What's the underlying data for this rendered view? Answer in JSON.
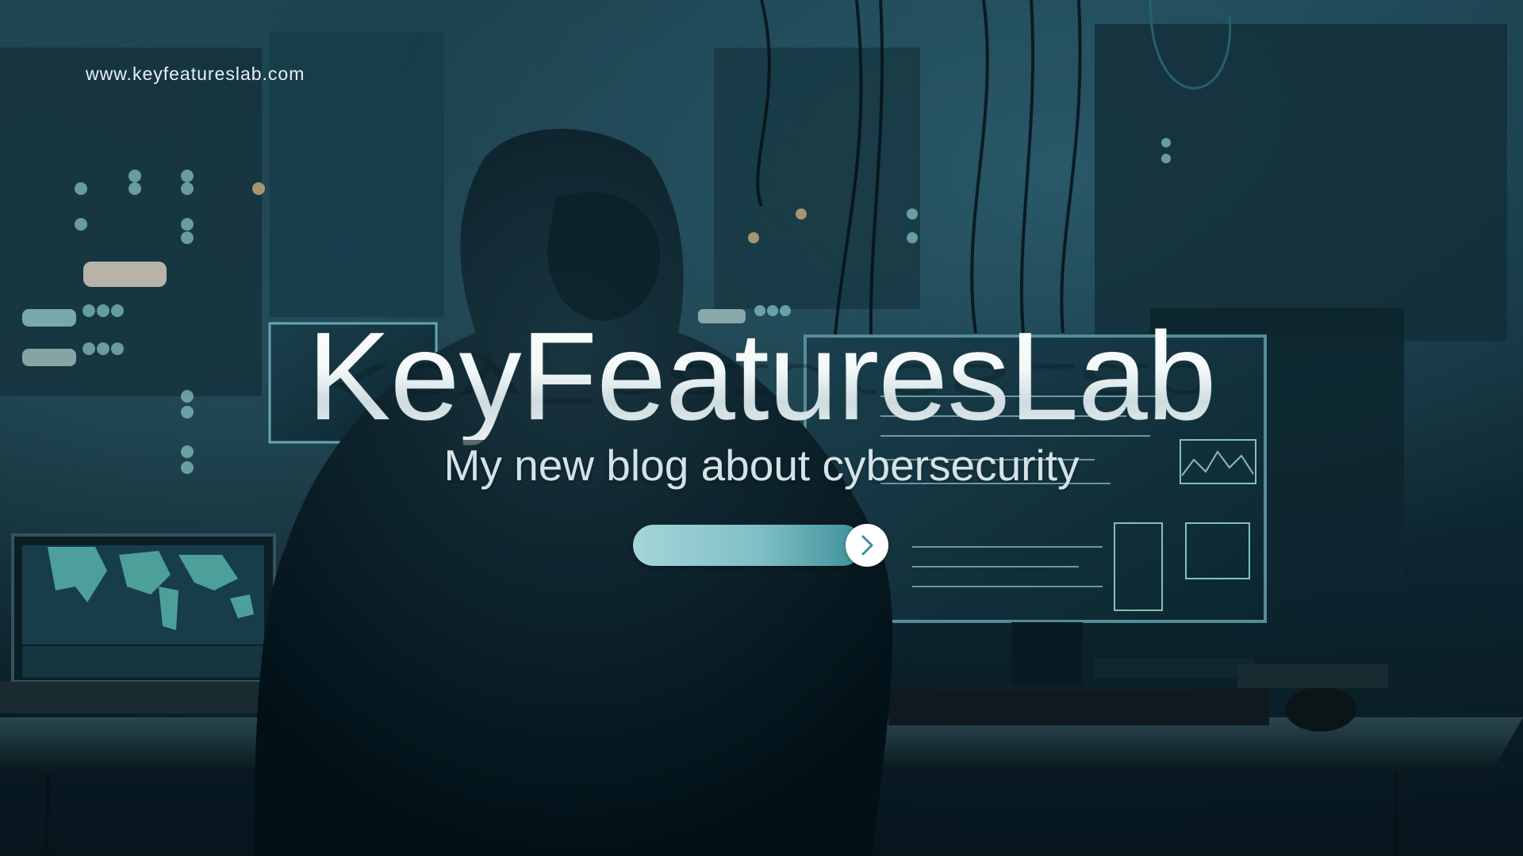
{
  "site_url": "www.keyfeatureslab.com",
  "hero": {
    "title": "KeyFeaturesLab",
    "subtitle": "My new blog about cybersecurity"
  },
  "cta": {
    "icon": "chevron-right-icon"
  },
  "colors": {
    "cta_gradient_start": "#a4d5d9",
    "cta_gradient_end": "#3c8f98",
    "background_dark": "#0a1c24",
    "accent_teal": "#3c8f98"
  }
}
